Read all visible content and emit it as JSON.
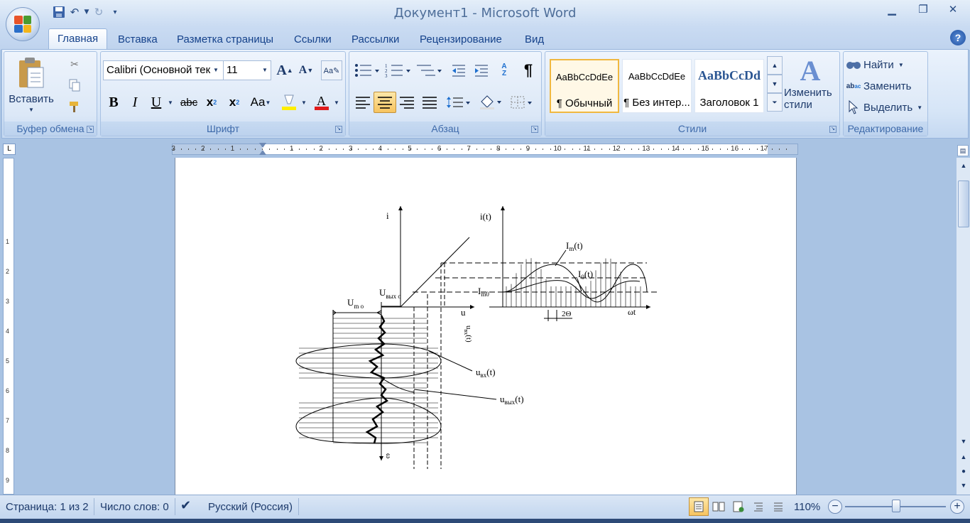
{
  "window": {
    "title": "Документ1 - Microsoft Word"
  },
  "tabs": [
    "Главная",
    "Вставка",
    "Разметка страницы",
    "Ссылки",
    "Рассылки",
    "Рецензирование",
    "Вид"
  ],
  "clipboard": {
    "paste": "Вставить",
    "label": "Буфер обмена"
  },
  "font": {
    "name": "Calibri (Основной тек",
    "size": "11",
    "label": "Шрифт"
  },
  "paragraph": {
    "label": "Абзац"
  },
  "styles": {
    "label": "Стили",
    "change": "Изменить стили",
    "tiles": [
      {
        "sample": "AaBbCcDdEe",
        "name": "¶ Обычный"
      },
      {
        "sample": "AaBbCcDdEe",
        "name": "¶ Без интер..."
      },
      {
        "sample": "AaBbCcDd",
        "name": "Заголовок 1"
      }
    ]
  },
  "editing": {
    "label": "Редактирование",
    "find": "Найти",
    "replace": "Заменить",
    "select": "Выделить"
  },
  "ruler": {
    "marks": [
      "3",
      "2",
      "1",
      "1",
      "2",
      "3",
      "4",
      "5",
      "6",
      "7",
      "8",
      "9",
      "10",
      "11",
      "12",
      "13",
      "14",
      "15",
      "16",
      "17"
    ]
  },
  "figure": {
    "i": "i",
    "it": "i(t)",
    "Im": "I",
    "Im_sub": "m",
    "Im_t": "(t)",
    "I0": "I",
    "I0_sub": "0",
    "I0_t": "(t)",
    "Im0": "I",
    "Im0_sub": "m0",
    "Uvyx0": "U",
    "Uvyx0_sub": "вых o",
    "Um0": "U",
    "Um0_sub": "m o",
    "u": "u",
    "uvx": "u",
    "uvx_sub": "вх",
    "uvx_t": "(t)",
    "uvyx": "u",
    "uvyx_sub": "вых",
    "uvyx_t": "(t)",
    "theta2": "2Θ",
    "omegat": "ωt",
    "omega": "ω",
    "uvx_rot": "u",
    "uvx_rot_sub": "вх",
    "uvx_rot_t": "(t)"
  },
  "status": {
    "page": "Страница: 1 из 2",
    "words": "Число слов: 0",
    "lang": "Русский (Россия)",
    "zoom": "110%"
  }
}
